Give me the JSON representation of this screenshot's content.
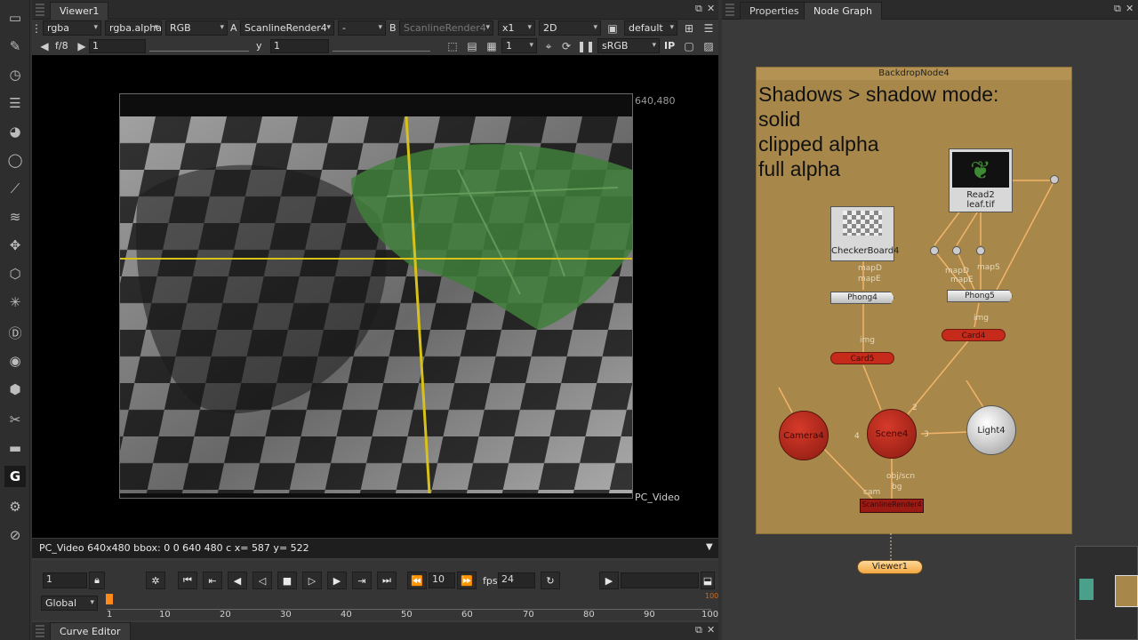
{
  "viewer": {
    "tab_title": "Viewer1",
    "channels": "rgba",
    "alpha": "rgba.alpha",
    "display": "RGB",
    "input_a_label": "A",
    "input_a": "ScanlineRender4",
    "composite": "-",
    "input_b_label": "B",
    "input_b": "ScanlineRender4",
    "zoom": "x1",
    "view_mode": "2D",
    "lut_default": "default",
    "fstop": "f/8",
    "gain_value": "1",
    "gamma_label": "y",
    "gamma_value": "1",
    "proxy_value": "1",
    "colorspace": "sRGB",
    "ip_label": "IP",
    "format_label": "640,480",
    "format_name": "PC_Video",
    "status_text": "PC_Video 640x480 bbox: 0 0 640 480 c  x= 587 y= 522"
  },
  "timeline": {
    "current_frame": "1",
    "increment": "10",
    "fps_label": "fps",
    "fps": "24",
    "range_mode": "Global",
    "ticks": [
      "1",
      "10",
      "20",
      "30",
      "40",
      "50",
      "60",
      "70",
      "80",
      "90",
      "100"
    ],
    "end_marker": "100",
    "curve_editor_tab": "Curve Editor"
  },
  "right_panel": {
    "tabs": [
      {
        "label": "Properties"
      },
      {
        "label": "Node Graph"
      }
    ]
  },
  "node_graph": {
    "backdrop_title": "BackdropNode4",
    "backdrop_note": [
      "Shadows > shadow mode:",
      "solid",
      "clipped alpha",
      "full alpha"
    ],
    "nodes": {
      "checkerboard": "CheckerBoard4",
      "read_line1": "Read2",
      "read_line2": "leaf.tif",
      "phong4": "Phong4",
      "phong5": "Phong5",
      "card5": "Card5",
      "card4": "Card4",
      "camera": "Camera4",
      "scene": "Scene4",
      "light": "Light4",
      "scanline": "ScanlineRender4",
      "viewer": "Viewer1"
    },
    "edge_labels": {
      "mapd_left": "mapD",
      "mape_left": "mapE",
      "mapd_right": "mapD",
      "mape_right": "mapE",
      "maps_right": "mapS",
      "img_left": "img",
      "img_right": "img",
      "scene_in2": "2",
      "scene_in3": "3",
      "scene_in4": "4",
      "obj_scn": "obj/scn",
      "bg": "bg",
      "cam": "cam"
    }
  }
}
